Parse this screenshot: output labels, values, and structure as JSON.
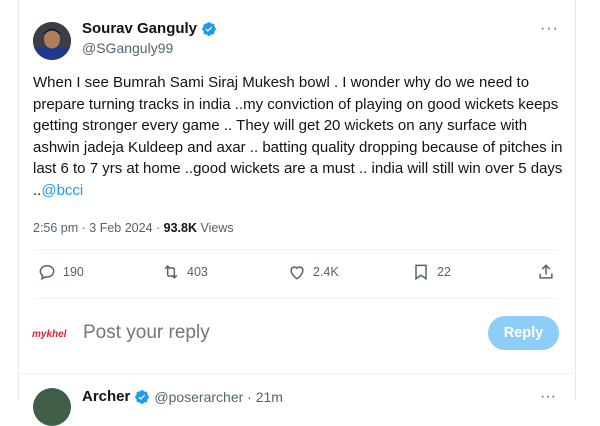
{
  "tweet": {
    "author_name": "Sourav Ganguly",
    "author_handle": "@SGanguly99",
    "more_label": "···",
    "text": "When I see Bumrah Sami Siraj Mukesh bowl . I wonder why do we need to prepare turning tracks in india ..my conviction of playing on good wickets keeps getting stronger every game .. They will get 20 wickets on any surface with ashwin jadeja Kuldeep and axar .. batting quality dropping because of pitches in last 6 to 7 yrs at home ..good wickets are a must .. india will still win over 5 days ..",
    "mention": "@bcci",
    "timestamp": "2:56 pm · 3 Feb 2024 · ",
    "views_count": "93.8K",
    "views_label": " Views",
    "verified_color": "#1d9bf0"
  },
  "actions": {
    "replies": "190",
    "retweets": "403",
    "likes": "2.4K",
    "bookmarks": "22"
  },
  "composer": {
    "avatar_text": "mykhel",
    "placeholder": "Post your reply",
    "reply_label": "Reply"
  },
  "next_reply": {
    "author_name": "Archer",
    "author_handle": "@poserarcher · 21m",
    "more_label": "···"
  },
  "icons": [
    "verified-badge-icon",
    "more-icon",
    "reply-icon",
    "retweet-icon",
    "like-icon",
    "bookmark-icon",
    "share-icon"
  ]
}
